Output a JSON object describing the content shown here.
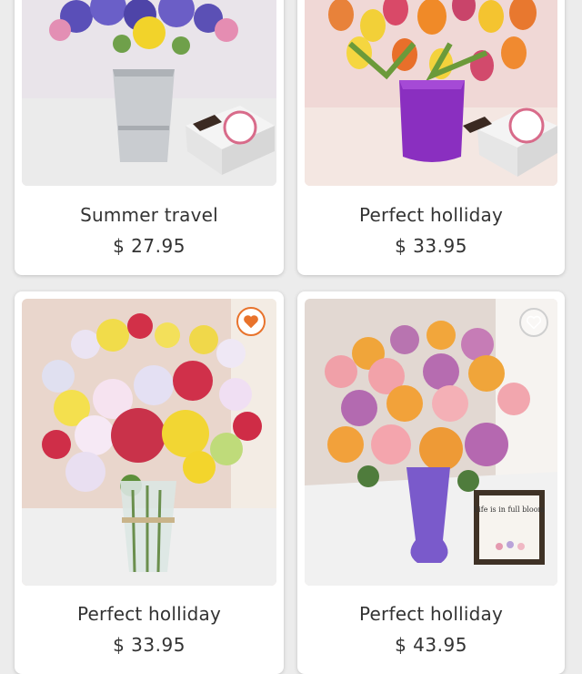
{
  "colors": {
    "accent": "#e8732c",
    "text": "#333333",
    "page_bg": "#ececec",
    "card_bg": "#ffffff"
  },
  "products": [
    {
      "name": "Summer travel",
      "price": "$ 27.95",
      "favorite": false,
      "photo": "iris-bouquet-metal-vase"
    },
    {
      "name": "Perfect holliday",
      "price": "$ 33.95",
      "favorite": false,
      "photo": "tulips-purple-vase"
    },
    {
      "name": "Perfect holliday",
      "price": "$ 33.95",
      "favorite": true,
      "photo": "lily-rose-bouquet-glass-vase",
      "favorite_icon": "heart-filled-icon"
    },
    {
      "name": "Perfect holliday",
      "price": "$ 43.95",
      "favorite": false,
      "photo": "roses-purple-vase",
      "favorite_icon": "heart-outline-icon",
      "sign_text": "Life is in full bloom"
    }
  ]
}
